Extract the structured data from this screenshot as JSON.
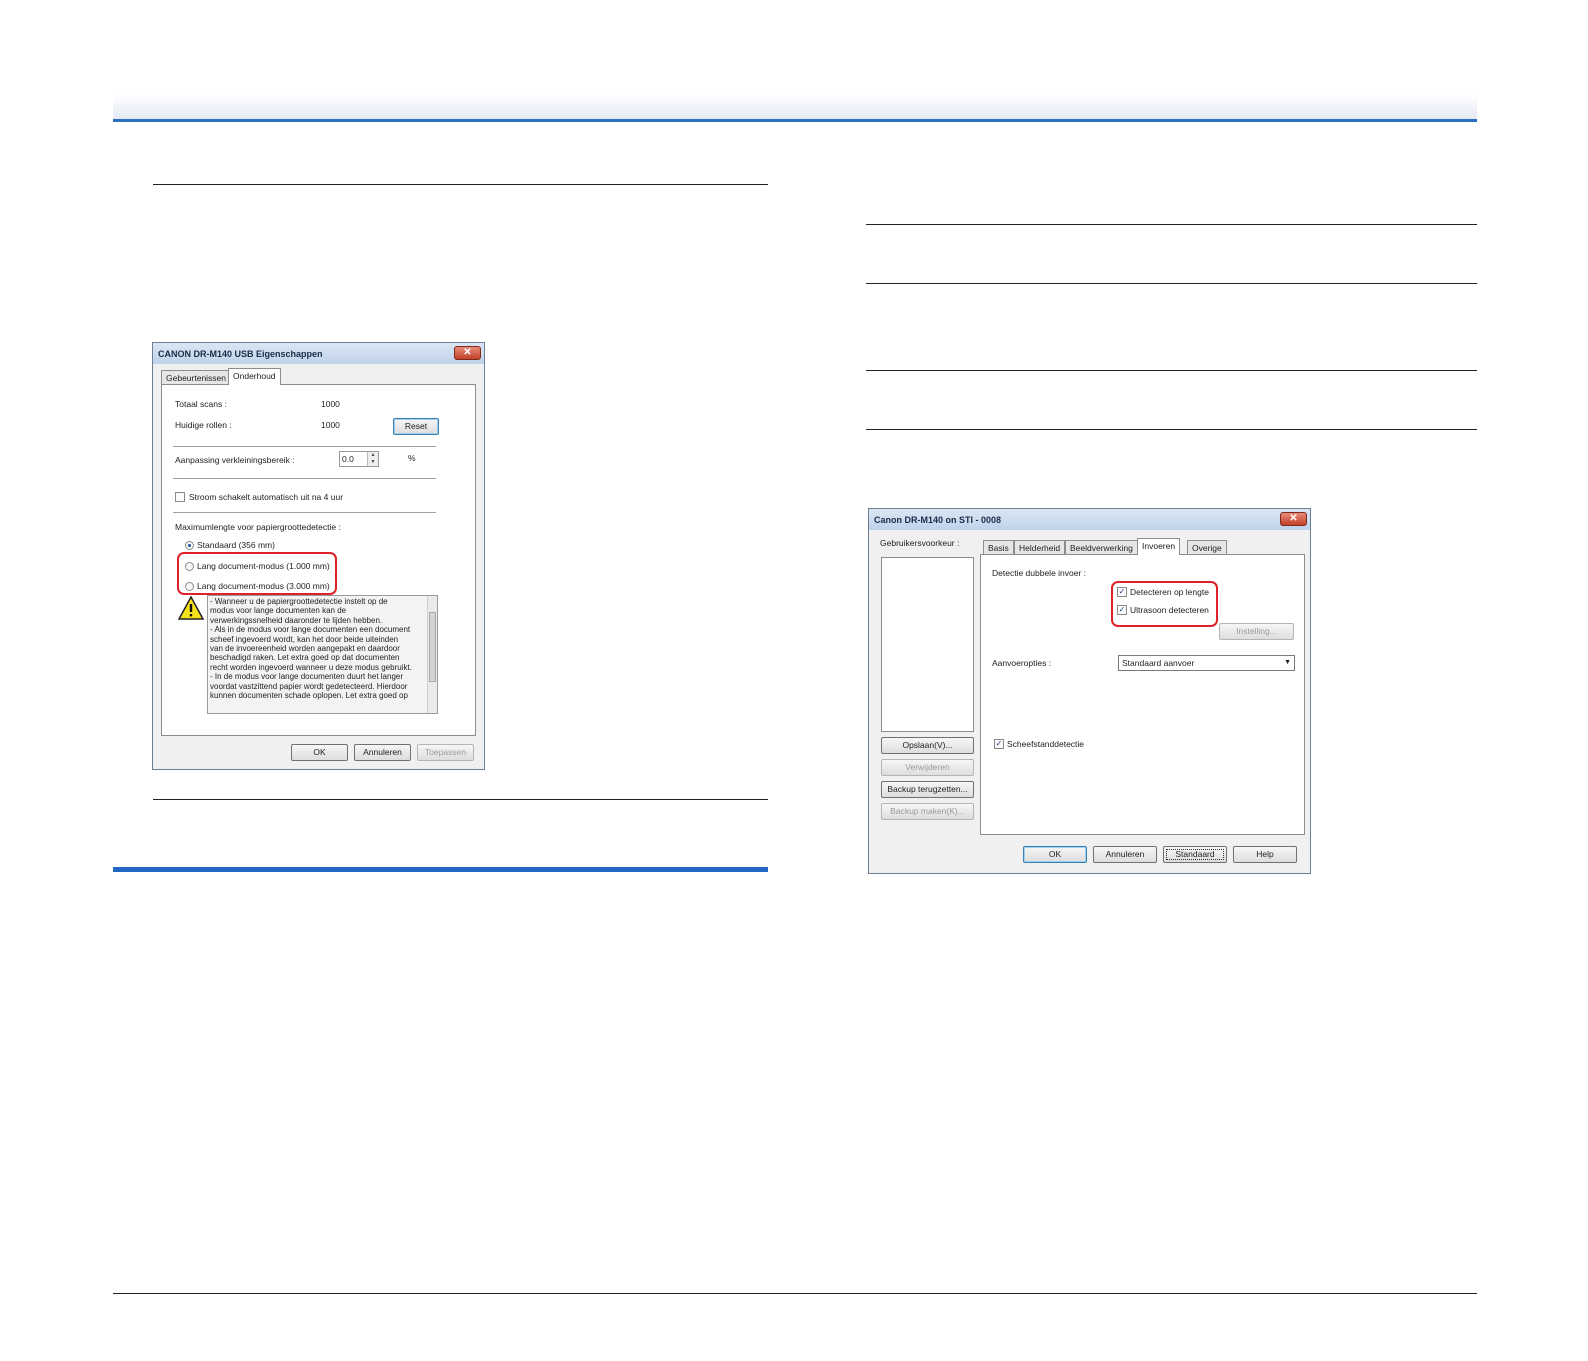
{
  "dialog1": {
    "title": "CANON DR-M140 USB Eigenschappen",
    "close_glyph": "✕",
    "tabs": [
      "Gebeurtenissen",
      "Onderhoud"
    ],
    "total_scans_label": "Totaal scans :",
    "total_scans_value": "1000",
    "current_roller_label": "Huidige rollen :",
    "current_roller_value": "1000",
    "reset_label": "Reset",
    "reduction_label": "Aanpassing verkleiningsbereik :",
    "reduction_value": "0.0",
    "reduction_unit": "%",
    "power_off_label": "Stroom schakelt automatisch uit na 4 uur",
    "max_length_label": "Maximumlengte voor papiergroottedetectie :",
    "radio_standard": "Standaard (356 mm)",
    "radio_long1": "Lang document-modus (1.000 mm)",
    "radio_long2": "Lang document-modus (3.000 mm)",
    "warning_lines": [
      "- Wanneer u de papiergroottedetectie instelt op de",
      "modus voor lange documenten kan de",
      "verwerkingssnelheid daaronder te lijden hebben.",
      "- Als in de modus voor lange documenten een document",
      "scheef ingevoerd wordt, kan het door beide uiteinden",
      "van de invoereenheid worden aangepakt en daardoor",
      "beschadigd raken. Let extra goed op dat documenten",
      "recht worden ingevoerd wanneer u deze modus gebruikt.",
      "- In de modus voor lange documenten duurt het langer",
      "voordat vastzittend papier wordt gedetecteerd. Hierdoor",
      "kunnen documenten schade oplopen. Let extra goed op"
    ],
    "ok_label": "OK",
    "cancel_label": "Annuleren",
    "apply_label": "Toepassen"
  },
  "dialog2": {
    "title": "Canon DR-M140 on STI - 0008",
    "close_glyph": "✕",
    "user_prefs_label": "Gebruikersvoorkeur :",
    "tabs": [
      "Basis",
      "Helderheid",
      "Beeldverwerking",
      "Invoeren",
      "Overige"
    ],
    "double_feed_label": "Detectie dubbele invoer :",
    "detect_length_label": "Detecteren op lengte",
    "ultrasonic_label": "Ultrasoon detecteren",
    "settings_label": "Instelling...",
    "feed_options_label": "Aanvoeropties :",
    "feed_options_value": "Standaard aanvoer",
    "skew_label": "Scheefstanddetectie",
    "save_label": "Opslaan(V)...",
    "delete_label": "Verwijderen",
    "restore_label": "Backup terugzetten...",
    "backup_label": "Backup maken(K)...",
    "ok_label": "OK",
    "cancel_label": "Annuleren",
    "default_label": "Standaard",
    "help_label": "Help"
  }
}
